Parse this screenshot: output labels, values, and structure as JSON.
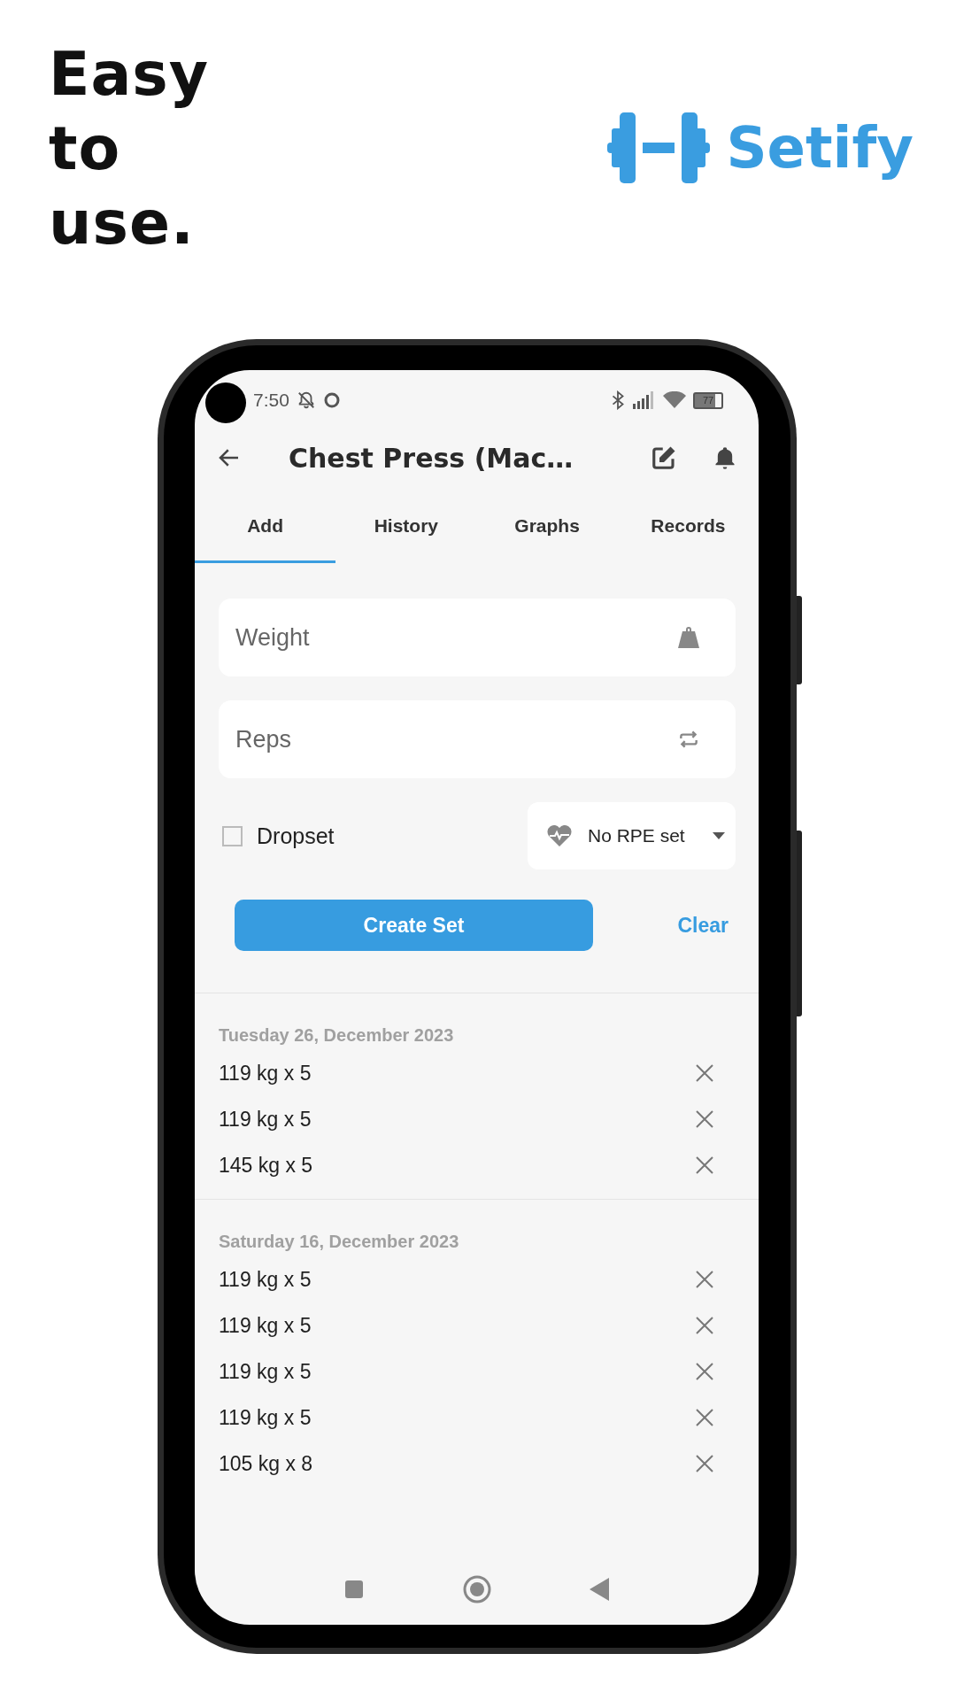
{
  "headline": "Easy to use.",
  "brand": {
    "name": "Setify"
  },
  "status_bar": {
    "time": "7:50",
    "battery": "77"
  },
  "app_bar": {
    "title": "Chest Press (Mac…"
  },
  "tabs": [
    {
      "label": "Add",
      "selected": true
    },
    {
      "label": "History",
      "selected": false
    },
    {
      "label": "Graphs",
      "selected": false
    },
    {
      "label": "Records",
      "selected": false
    }
  ],
  "form": {
    "weight": {
      "placeholder": "Weight"
    },
    "reps": {
      "placeholder": "Reps"
    },
    "dropset": {
      "label": "Dropset",
      "checked": false
    },
    "rpe": {
      "value": "No RPE set"
    },
    "buttons": {
      "primary": "Create Set",
      "secondary": "Clear"
    }
  },
  "history": [
    {
      "date": "Tuesday 26, December 2023",
      "sets": [
        "119 kg x 5",
        "119 kg x 5",
        "145 kg x 5"
      ]
    },
    {
      "date": "Saturday 16, December 2023",
      "sets": [
        "119 kg x 5",
        "119 kg x 5",
        "119 kg x 5",
        "119 kg x 5",
        "105 kg x 8"
      ]
    }
  ]
}
